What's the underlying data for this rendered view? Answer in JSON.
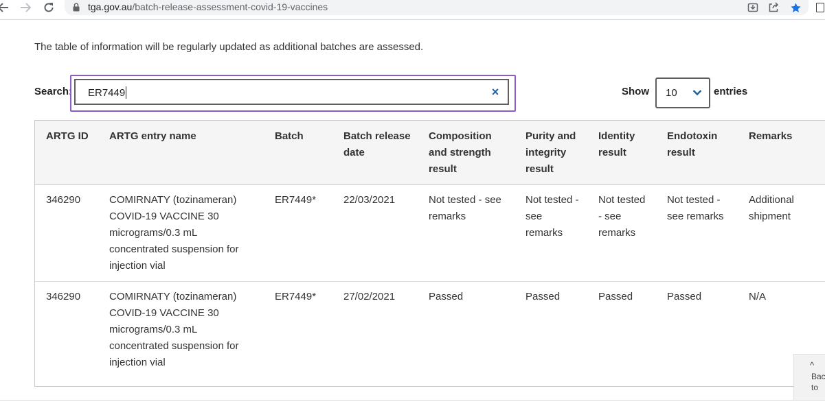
{
  "browser": {
    "url_host": "tga.gov.au",
    "url_path": "/batch-release-assessment-covid-19-vaccines"
  },
  "page": {
    "intro": "The table of information will be regularly updated as additional batches are assessed."
  },
  "search": {
    "label": "Search:",
    "value": "ER7449",
    "clear_icon": "×"
  },
  "length_menu": {
    "show_label": "Show",
    "selected": "10",
    "entries_label": "entries"
  },
  "table": {
    "columns": [
      "ARTG ID",
      "ARTG entry name",
      "Batch",
      "Batch release date",
      "Composition and strength result",
      "Purity and integrity result",
      "Identity result",
      "Endotoxin result",
      "Remarks"
    ],
    "rows": [
      [
        "346290",
        "COMIRNATY (tozinameran) COVID-19 VACCINE 30 micrograms/0.3 mL concentrated suspension for injection vial",
        "ER7449*",
        "22/03/2021",
        "Not tested - see remarks",
        "Not tested - see remarks",
        "Not tested - see remarks",
        "Not tested - see remarks",
        "Additional shipment"
      ],
      [
        "346290",
        "COMIRNATY (tozinameran) COVID-19 VACCINE 30 micrograms/0.3 mL concentrated suspension for injection vial",
        "ER7449*",
        "27/02/2021",
        "Passed",
        "Passed",
        "Passed",
        "Passed",
        "N/A"
      ]
    ]
  },
  "back_to_top": {
    "line1": "Bac",
    "line2": "to"
  },
  "colors": {
    "focus_ring": "#8a5cc4",
    "link_blue": "#1f5f9e",
    "header_bg": "#f5f5f5"
  }
}
